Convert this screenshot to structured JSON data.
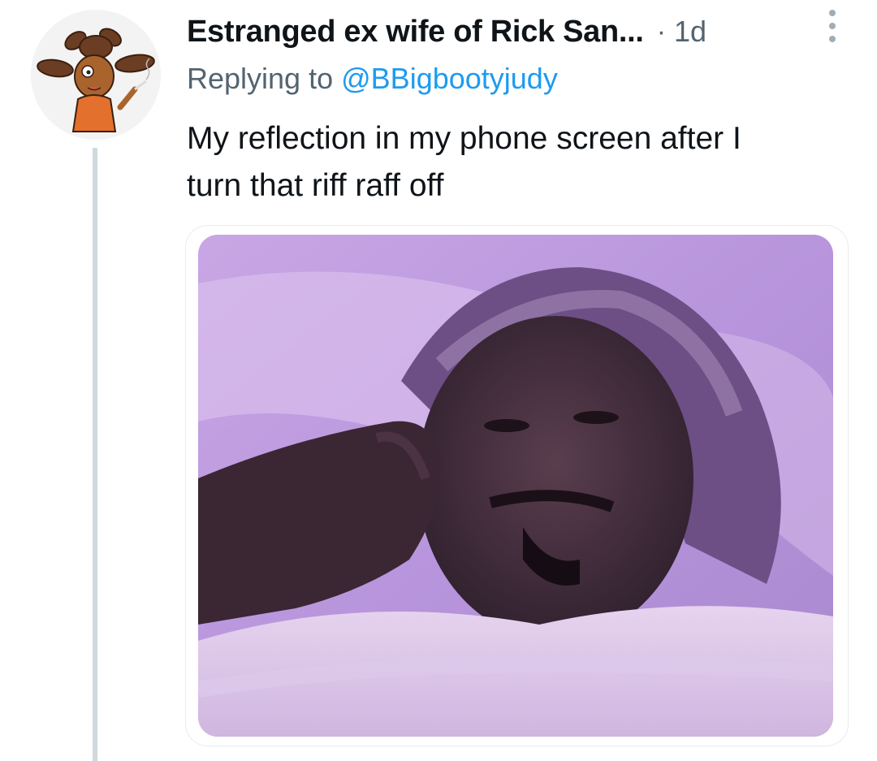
{
  "tweet": {
    "display_name": "Estranged ex wife of Rick San...",
    "separator": "·",
    "time": "1d",
    "replying_prefix": "Replying to",
    "replying_handle": "@BBigbootyjudy",
    "text_line1": "My reflection in my phone screen after I",
    "text_line2": "turn that riff raff off",
    "avatar_icon": "cartoon-character-avatar-icon",
    "more_icon": "more-options-icon",
    "photo_description_icon": "photo"
  },
  "colors": {
    "link": "#1d9bf0",
    "secondary_text": "#536471",
    "primary_text": "#0f1419",
    "thread_line": "#cfd9de",
    "photo_tint": "#b08fd6"
  }
}
